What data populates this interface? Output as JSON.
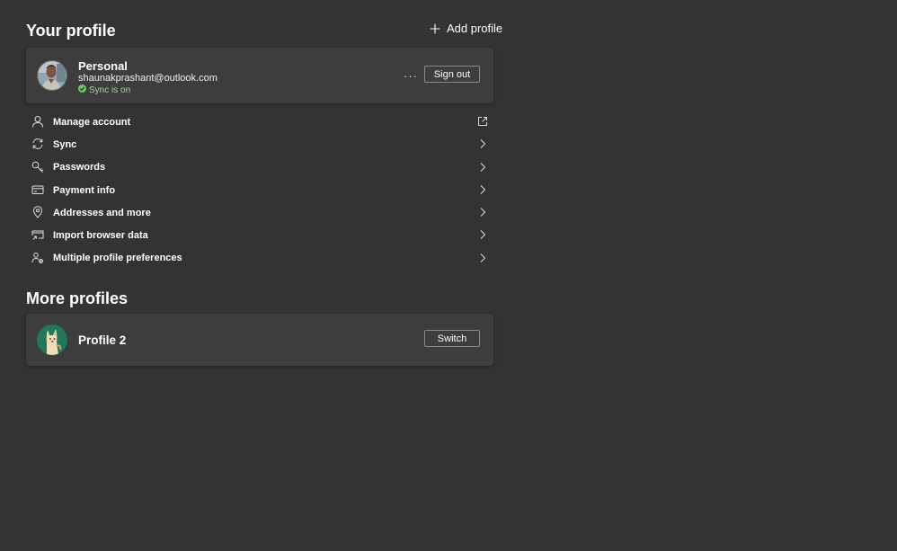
{
  "header": {
    "title": "Your profile",
    "add_profile_label": "Add profile"
  },
  "profile": {
    "name": "Personal",
    "email": "shaunakprashant@outlook.com",
    "sync_status": "Sync is on",
    "more_label": "···",
    "sign_out_label": "Sign out"
  },
  "menu": {
    "items": [
      {
        "label": "Manage account",
        "icon": "person-icon",
        "trail": "external-link-icon"
      },
      {
        "label": "Sync",
        "icon": "sync-icon",
        "trail": "chevron-right-icon"
      },
      {
        "label": "Passwords",
        "icon": "key-icon",
        "trail": "chevron-right-icon"
      },
      {
        "label": "Payment info",
        "icon": "credit-card-icon",
        "trail": "chevron-right-icon"
      },
      {
        "label": "Addresses and more",
        "icon": "location-pin-icon",
        "trail": "chevron-right-icon"
      },
      {
        "label": "Import browser data",
        "icon": "import-icon",
        "trail": "chevron-right-icon"
      },
      {
        "label": "Multiple profile preferences",
        "icon": "profiles-settings-icon",
        "trail": "chevron-right-icon"
      }
    ]
  },
  "more_profiles": {
    "title": "More profiles",
    "items": [
      {
        "name": "Profile 2",
        "switch_label": "Switch"
      }
    ]
  },
  "colors": {
    "background": "#333333",
    "card": "#3d3d3d",
    "sync_green": "#6ccb5f"
  }
}
